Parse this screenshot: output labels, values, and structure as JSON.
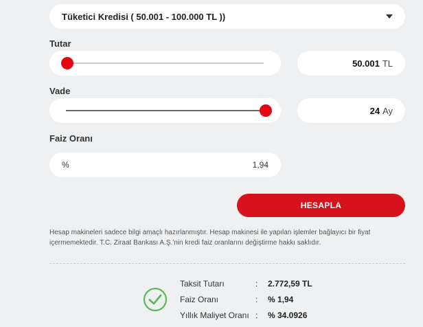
{
  "loan_type": {
    "selected": "Tüketici Kredisi ( 50.001 - 100.000 TL ))"
  },
  "tutar": {
    "label": "Tutar",
    "value": "50.001",
    "unit": "TL",
    "slider_fraction": 0.0
  },
  "vade": {
    "label": "Vade",
    "value": "24",
    "unit": "Ay",
    "slider_fraction": 1.0
  },
  "faiz": {
    "label": "Faiz Oranı",
    "prefix": "%",
    "value": "1,94"
  },
  "actions": {
    "calculate_label": "HESAPLA"
  },
  "disclaimer": "Hesap makineleri sadece bilgi amaçlı hazırlanmıştır. Hesap makinesi ile yapılan işlemler bağlayıcı bir fiyat içermemektedir. T.C. Ziraat Bankası A.Ş.'nin kredi faiz oranlarını değiştirme hakkı saklıdır.",
  "results": {
    "rows": [
      {
        "key": "Taksit Tutarı",
        "sep": ":",
        "value": "2.772,59 TL"
      },
      {
        "key": "Faiz Oranı",
        "sep": ":",
        "value": "% 1,94"
      },
      {
        "key": "Yıllık Maliyet Oranı",
        "sep": ":",
        "value": "% 34.0926"
      }
    ]
  },
  "colors": {
    "accent": "#e30613",
    "button": "#d6121c",
    "background": "#eef0f2",
    "check": "#5cb85c"
  },
  "icons": {
    "select_caret": "caret-down-icon",
    "success": "check-circle-icon"
  }
}
